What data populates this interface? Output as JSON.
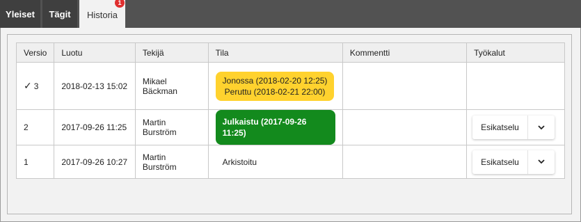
{
  "tabs": {
    "yleiset": "Yleiset",
    "tagit": "Tägit",
    "historia": "Historia",
    "historia_badge": "1"
  },
  "table": {
    "headers": {
      "versio": "Versio",
      "luotu": "Luotu",
      "tekija": "Tekijä",
      "tila": "Tila",
      "kommentti": "Kommentti",
      "tyokalut": "Työkalut"
    },
    "rows": [
      {
        "check": "✓",
        "version": "3",
        "created": "2018-02-13 15:02",
        "author": "Mikael Bäckman",
        "status_line1": "Jonossa (2018-02-20 12:25)",
        "status_line2": "Peruttu (2018-02-21 22:00)",
        "status_color": "#ffd22e",
        "comment": ""
      },
      {
        "version": "2",
        "created": "2017-09-26 11:25",
        "author": "Martin Burström",
        "status": "Julkaistu (2017-09-26 11:25)",
        "status_color": "#138a1d",
        "comment": "",
        "tool_label": "Esikatselu"
      },
      {
        "version": "1",
        "created": "2017-09-26 10:27",
        "author": "Martin Burström",
        "status": "Arkistoitu",
        "comment": "",
        "tool_label": "Esikatselu"
      }
    ]
  },
  "icons": {
    "dropdown": "chevron-down-icon",
    "check": "check-icon"
  }
}
